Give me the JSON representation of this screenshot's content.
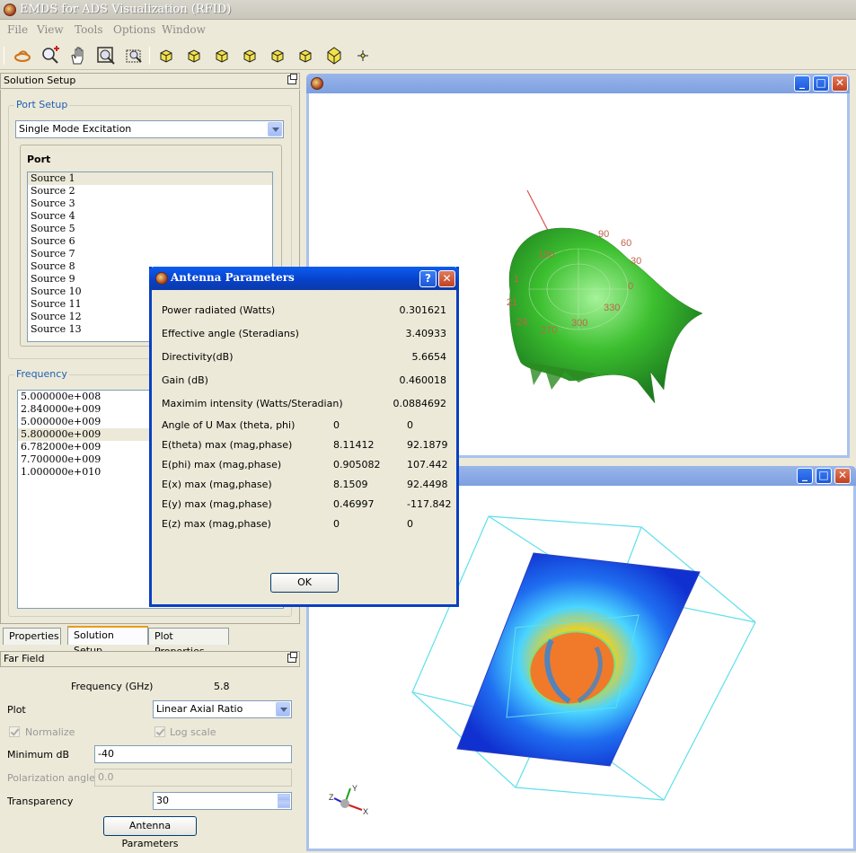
{
  "app": {
    "title": "EMDS for ADS Visualization (RFID)"
  },
  "menu": [
    "File",
    "View",
    "Tools",
    "Options",
    "Window"
  ],
  "toolbar": {
    "icons": [
      "rotate-icon",
      "zoom-in-icon",
      "pan-hand-icon",
      "zoom-fit-icon",
      "zoom-window-icon",
      "view-front-icon",
      "view-back-icon",
      "view-left-icon",
      "view-right-icon",
      "view-top-icon",
      "view-iso-icon",
      "origin-icon"
    ]
  },
  "solution_setup": {
    "header": "Solution Setup",
    "port_setup_title": "Port Setup",
    "excitation": "Single Mode Excitation",
    "port_label": "Port",
    "ports": [
      "Source 1",
      "Source 2",
      "Source 3",
      "Source 4",
      "Source 5",
      "Source 6",
      "Source 7",
      "Source 8",
      "Source 9",
      "Source 10",
      "Source 11",
      "Source 12",
      "Source 13"
    ],
    "frequency_title": "Frequency",
    "frequencies": [
      "5.000000e+008",
      "2.840000e+009",
      "5.000000e+009",
      "5.800000e+009",
      "6.782000e+009",
      "7.700000e+009",
      "1.000000e+010"
    ]
  },
  "tabs": [
    "Properties",
    "Solution Setup",
    "Plot Properties"
  ],
  "far_field": {
    "header": "Far Field",
    "frequency_label": "Frequency (GHz)",
    "frequency_value": "5.8",
    "plot_label": "Plot",
    "plot_value": "Linear Axial Ratio",
    "normalize_label": "Normalize",
    "log_scale_label": "Log scale",
    "min_db_label": "Minimum dB",
    "min_db_value": "-40",
    "polarization_label": "Polarization angle",
    "polarization_value": "0.0",
    "transparency_label": "Transparency",
    "transparency_value": "30",
    "antenna_button": "Antenna Parameters"
  },
  "dialog": {
    "title": "Antenna Parameters",
    "help": "?",
    "rows": [
      {
        "label": "Power radiated (Watts)",
        "v1": "",
        "v2": "0.301621"
      },
      {
        "label": "Effective angle (Steradians)",
        "v1": "",
        "v2": "3.40933"
      },
      {
        "label": "Directivity(dB)",
        "v1": "",
        "v2": "5.6654"
      },
      {
        "label": "Gain (dB)",
        "v1": "",
        "v2": "0.460018"
      },
      {
        "label": "Maximim intensity (Watts/Steradian)",
        "v1": "",
        "v2": "0.0884692"
      },
      {
        "label": "Angle of U Max (theta, phi)",
        "v1": "0",
        "v2": "0"
      },
      {
        "label": "E(theta) max (mag,phase)",
        "v1": "8.11412",
        "v2": "92.1879"
      },
      {
        "label": "E(phi) max (mag,phase)",
        "v1": "0.905082",
        "v2": "107.442"
      },
      {
        "label": "E(x) max (mag,phase)",
        "v1": "8.1509",
        "v2": "92.4498"
      },
      {
        "label": "E(y) max (mag,phase)",
        "v1": "0.46997",
        "v2": "-117.842"
      },
      {
        "label": "E(z) max (mag,phase)",
        "v1": "0",
        "v2": "0"
      }
    ],
    "ok": "OK"
  },
  "far_field_plot": {
    "angle_labels": [
      "90",
      "60",
      "150",
      "30",
      "0",
      "1",
      "21",
      "24",
      "270",
      "300",
      "330"
    ]
  },
  "axes_triad": {
    "x": "X",
    "y": "Y",
    "z": "Z"
  },
  "colors": {
    "xp_blue": "#0a3fc4",
    "group_title": "#1f5fb4",
    "field_bg": "#1038d8",
    "surface_green": "#3bbf2c"
  }
}
